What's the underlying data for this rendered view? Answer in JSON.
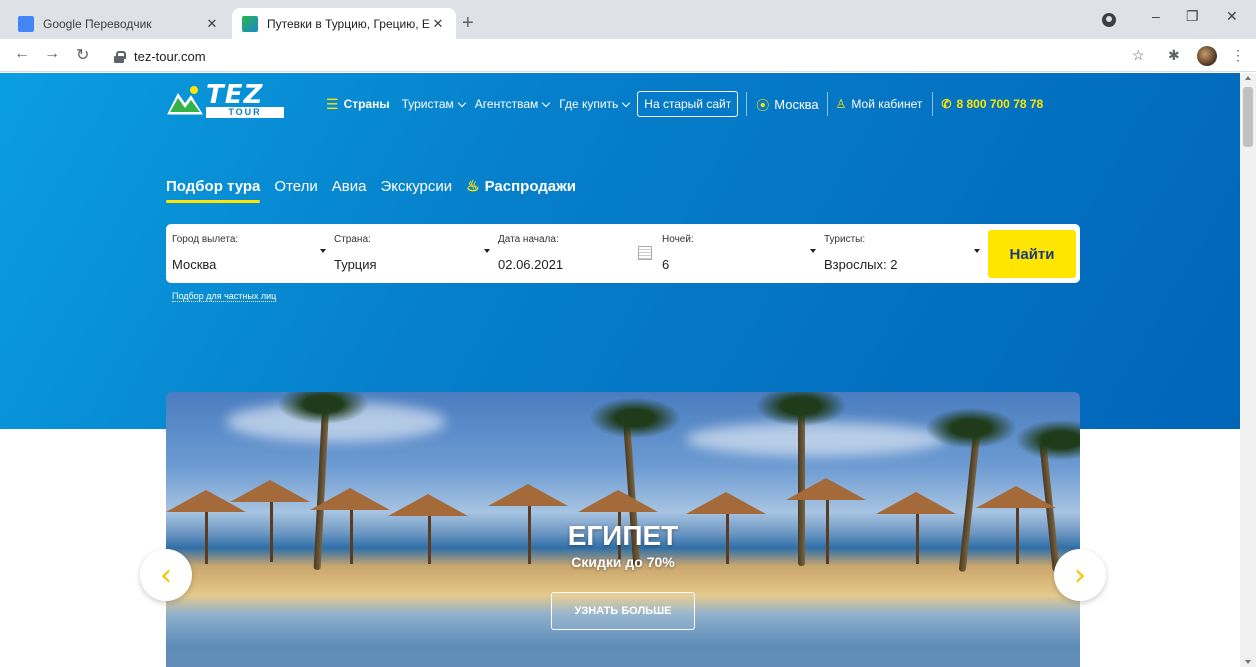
{
  "browser": {
    "tabs": [
      {
        "title": "Google Переводчик",
        "close": "✕",
        "icon": "google-translate-icon"
      },
      {
        "title": "Путевки в Турцию, Грецию, Еги",
        "close": "✕",
        "icon": "tez-tour-favicon"
      }
    ],
    "new_tab": "+",
    "url": "tez-tour.com",
    "controls": {
      "minimize": "–",
      "maximize": "❐",
      "close": "✕"
    }
  },
  "site": {
    "logo_text": "TEZ",
    "logo_sub": "TOUR",
    "nav": {
      "countries": "Страны",
      "tourists": "Туристам",
      "agencies": "Агентствам",
      "where_buy": "Где купить",
      "old_site": "На старый сайт",
      "city": "Москва",
      "cabinet": "Мой кабинет",
      "phone": "8 800 700 78 78"
    },
    "subnav": {
      "tour": "Подбор тура",
      "hotels": "Отели",
      "avia": "Авиа",
      "excursions": "Экскурсии",
      "sales": "Распродажи"
    },
    "search": {
      "departure_label": "Город вылета:",
      "departure_value": "Москва",
      "country_label": "Страна:",
      "country_value": "Турция",
      "date_label": "Дата начала:",
      "date_value": "02.06.2021",
      "nights_label": "Ночей:",
      "nights_value": "6",
      "tourists_label": "Туристы:",
      "tourists_value": "Взрослых: 2",
      "find_button": "Найти"
    },
    "private_link": "Подбор для частных лиц",
    "banner": {
      "title": "ЕГИПЕТ",
      "subtitle": "Скидки до 70%",
      "button": "УЗНАТЬ БОЛЬШЕ",
      "prev": "‹",
      "next": "›"
    }
  },
  "colors": {
    "hero_blue": "#067fcb",
    "accent_yellow": "#ffe600",
    "button_text": "#1c3d73"
  }
}
